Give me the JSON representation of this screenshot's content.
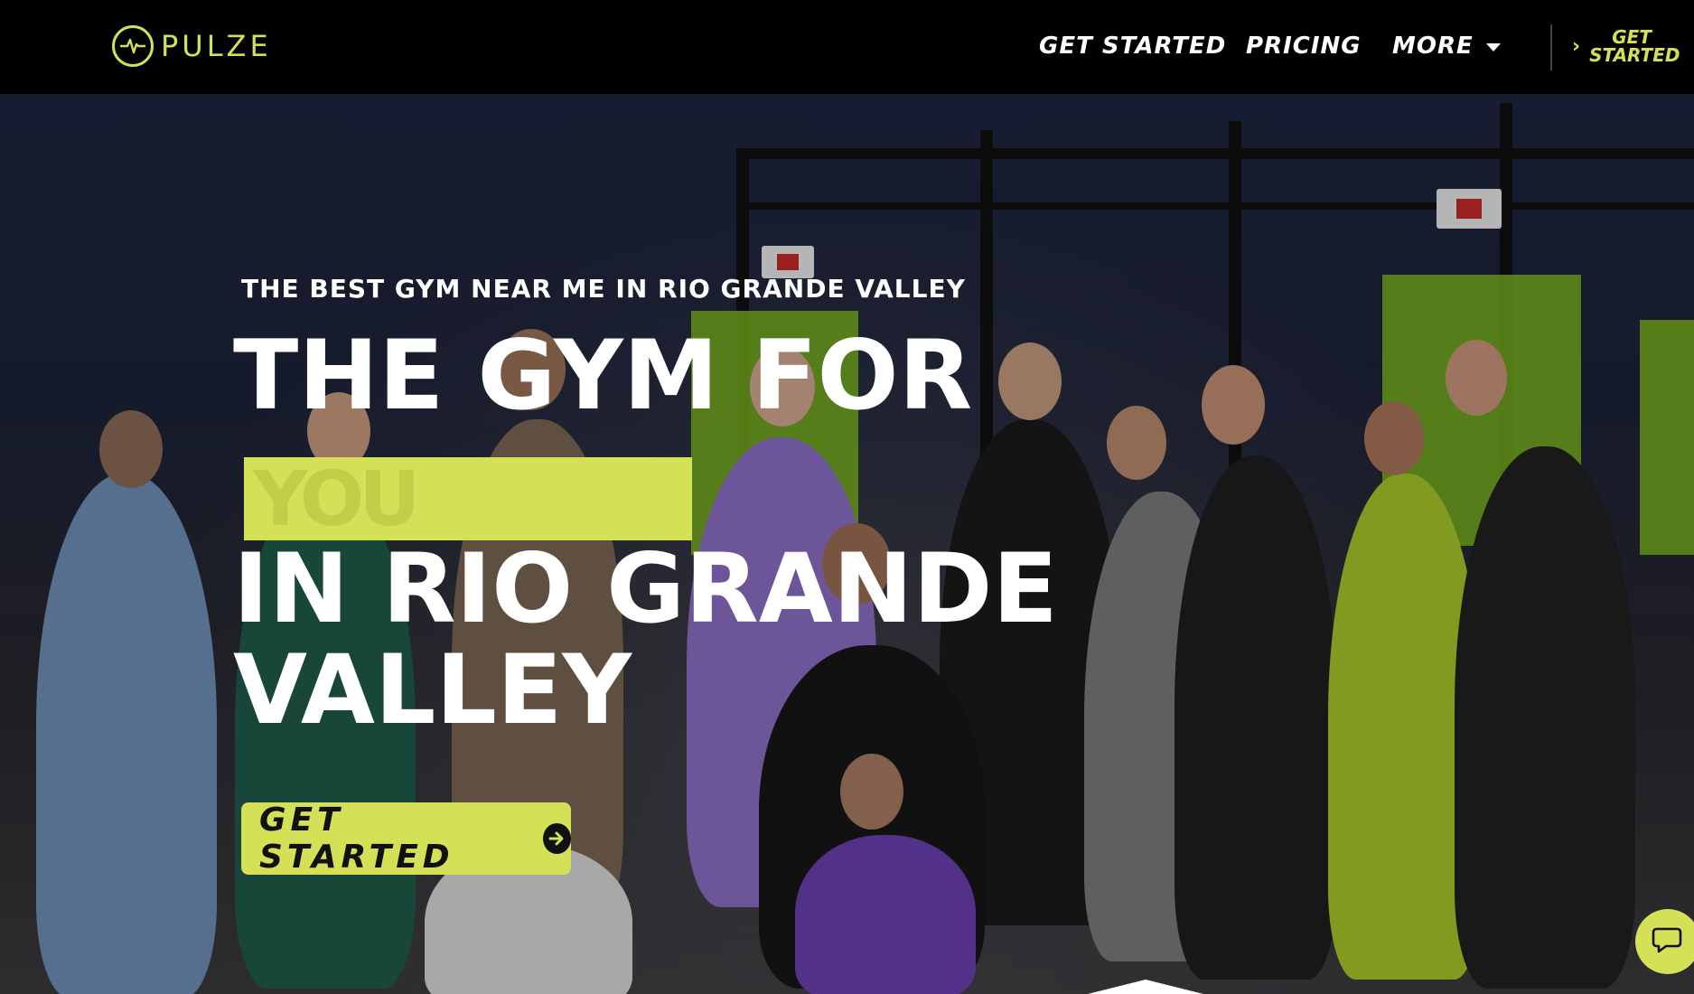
{
  "header": {
    "logo_text": "PULZE",
    "nav": {
      "get_started": "GET STARTED",
      "pricing": "PRICING",
      "more": "MORE"
    },
    "cta_label": "GET STARTED"
  },
  "hero": {
    "kicker": "THE BEST GYM NEAR ME IN RIO GRANDE VALLEY",
    "title_line1": "THE GYM FOR",
    "rotator_text": "YOU",
    "title_line2": "IN RIO GRANDE",
    "title_line3": "VALLEY",
    "cta_label": "GET STARTED"
  },
  "colors": {
    "accent": "#d4e157",
    "header_bg": "#000000",
    "text": "#ffffff"
  },
  "icons": {
    "logo": "pulse-heartbeat-icon",
    "more": "caret-down-icon",
    "header_cta": "chevron-right-icon",
    "hero_cta": "arrow-right-circle-icon",
    "chat": "chat-bubble-icon"
  }
}
